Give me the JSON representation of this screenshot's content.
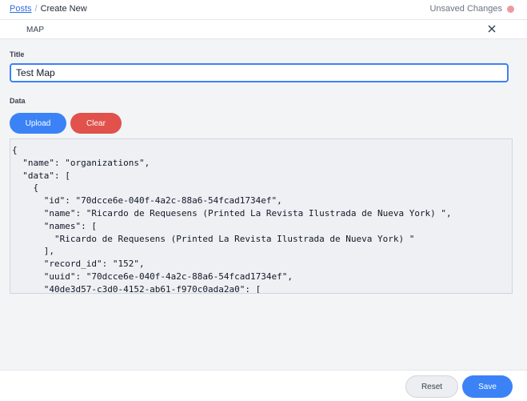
{
  "breadcrumb": {
    "parent": "Posts",
    "separator": "/",
    "current": "Create New"
  },
  "status": {
    "unsaved_label": "Unsaved Changes",
    "indicator_color": "#ee9aa0"
  },
  "section": {
    "title": "MAP",
    "close_icon": "close-icon"
  },
  "form": {
    "title_label": "Title",
    "title_value": "Test Map",
    "data_label": "Data",
    "upload_label": "Upload",
    "clear_label": "Clear"
  },
  "code_lines": [
    "{",
    "  \"name\": \"organizations\",",
    "  \"data\": [",
    "    {",
    "      \"id\": \"70dcce6e-040f-4a2c-88a6-54fcad1734ef\",",
    "      \"name\": \"Ricardo de Requesens (Printed La Revista Ilustrada de Nueva York) \",",
    "      \"names\": [",
    "        \"Ricardo de Requesens (Printed La Revista Ilustrada de Nueva York) \"",
    "      ],",
    "      \"record_id\": \"152\",",
    "      \"uuid\": \"70dcce6e-040f-4a2c-88a6-54fcad1734ef\",",
    "      \"40de3d57-c3d0-4152-ab61-f970c0ada2a0\": ["
  ],
  "footer": {
    "reset_label": "Reset",
    "save_label": "Save"
  },
  "colors": {
    "accent": "#3b82f6",
    "danger": "#e0524b"
  }
}
